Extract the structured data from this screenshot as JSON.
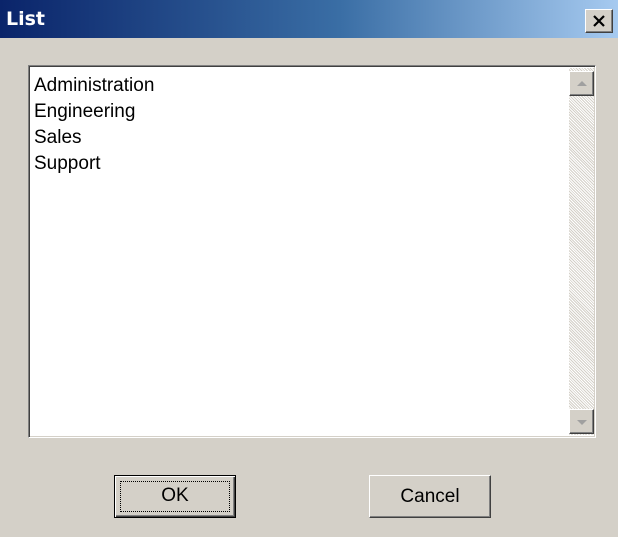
{
  "window": {
    "title": "List"
  },
  "titlebar": {
    "close_icon": "close-icon"
  },
  "list": {
    "items": [
      "Administration",
      "Engineering",
      "Sales",
      "Support"
    ]
  },
  "scrollbar": {
    "up_icon": "arrow-up-icon",
    "down_icon": "arrow-down-icon"
  },
  "buttons": {
    "ok_label": "OK",
    "cancel_label": "Cancel"
  },
  "colors": {
    "titlebar_start": "#0a246a",
    "titlebar_end": "#a6caf0",
    "face": "#d4d0c8"
  }
}
